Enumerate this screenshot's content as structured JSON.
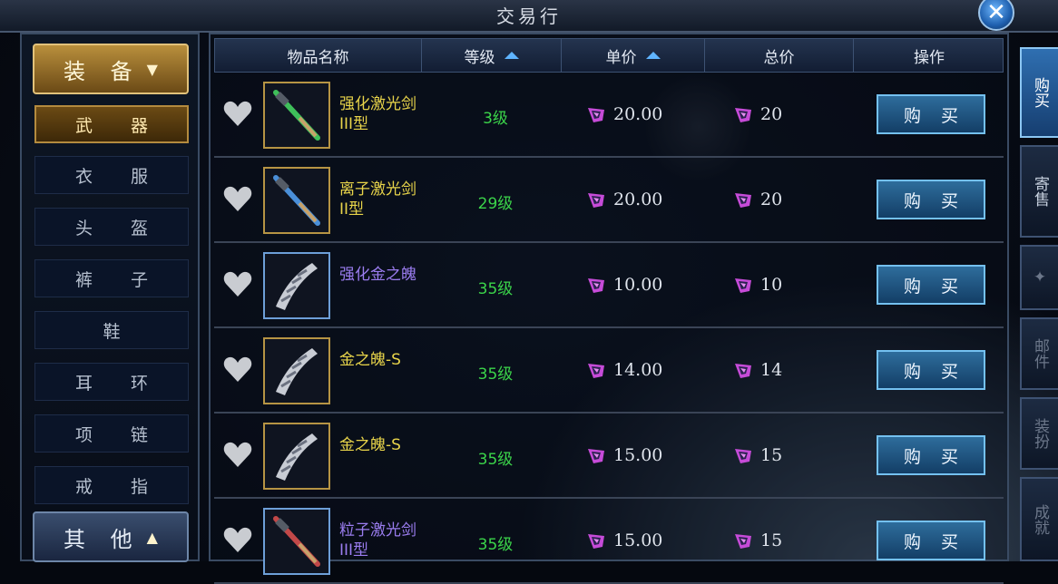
{
  "window": {
    "title": "交易行"
  },
  "categories": {
    "header": "装 备",
    "items": [
      "武 器",
      "衣 服",
      "头 盔",
      "裤 子",
      "鞋",
      "耳 环",
      "项 链",
      "戒 指"
    ],
    "active": "武 器",
    "footer": "其 他"
  },
  "table": {
    "headers": {
      "name": "物品名称",
      "level": "等级",
      "unit": "单价",
      "total": "总价",
      "action": "操作"
    },
    "rows": [
      {
        "name": "强化激光剑III型",
        "name_color": "#e8d44a",
        "level": "3级",
        "unit": "20.00",
        "total": "20",
        "buy": "购 买",
        "item_icon": "green-laser-sword-icon"
      },
      {
        "name": "离子激光剑II型",
        "name_color": "#e8d44a",
        "level": "29级",
        "unit": "20.00",
        "total": "20",
        "buy": "购 买",
        "item_icon": "blue-laser-sword-icon"
      },
      {
        "name": "强化金之魄",
        "name_color": "#9b7df0",
        "level": "35级",
        "unit": "10.00",
        "total": "10",
        "buy": "购 买",
        "item_icon": "metal-claw-icon"
      },
      {
        "name": "金之魄-S",
        "name_color": "#e8d44a",
        "level": "35级",
        "unit": "14.00",
        "total": "14",
        "buy": "购 买",
        "item_icon": "metal-claw-icon"
      },
      {
        "name": "金之魄-S",
        "name_color": "#e8d44a",
        "level": "35级",
        "unit": "15.00",
        "total": "15",
        "buy": "购 买",
        "item_icon": "metal-claw-icon"
      },
      {
        "name": "粒子激光剑III型",
        "name_color": "#9b7df0",
        "level": "35级",
        "unit": "15.00",
        "total": "15",
        "buy": "购 买",
        "item_icon": "red-laser-sword-icon"
      }
    ]
  },
  "right_tabs": [
    "购买",
    "寄售",
    "",
    "邮件",
    "装扮",
    "成就"
  ],
  "colors": {
    "gold": "#b69444",
    "accent_blue": "#5fb4ff",
    "level_green": "#3bd44a",
    "gem_purple": "#c64bd8"
  }
}
